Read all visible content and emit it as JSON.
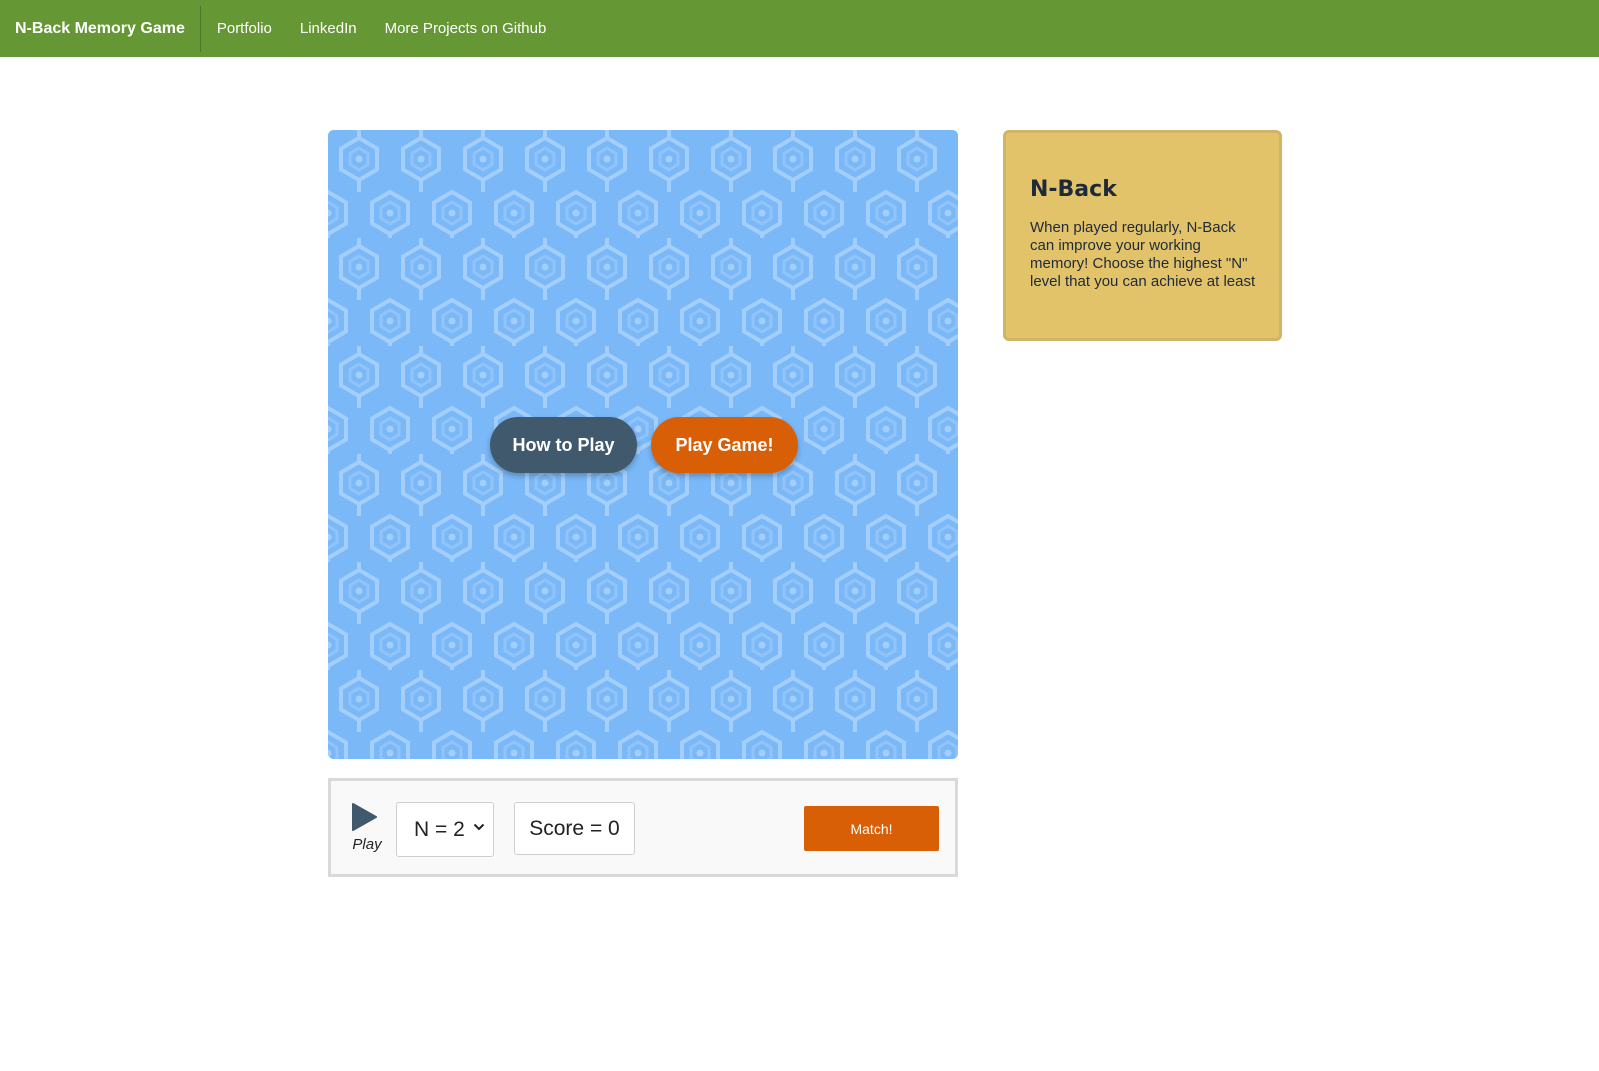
{
  "navbar": {
    "brand": "N-Back Memory Game",
    "links": [
      "Portfolio",
      "LinkedIn",
      "More Projects on Github"
    ],
    "background_color": "#659735"
  },
  "game_board": {
    "background_pattern": "hexagon-pattern",
    "base_color": "#7ab8f8",
    "how_to_play_label": "How to Play",
    "play_game_label": "Play Game!",
    "how_to_play_color": "#41596d",
    "play_game_color": "#d85f06"
  },
  "controls": {
    "play_label": "Play",
    "play_icon": "play-triangle-icon",
    "n_select": {
      "selected": "N = 2"
    },
    "score_text": "Score = 0",
    "match_label": "Match!",
    "match_color": "#d85f06"
  },
  "info_card": {
    "title": "N-Back",
    "text": "When played regularly, N-Back can improve your working memory! Choose the highest \"N\" level that you can achieve at least",
    "background_color": "#e3c36a"
  }
}
